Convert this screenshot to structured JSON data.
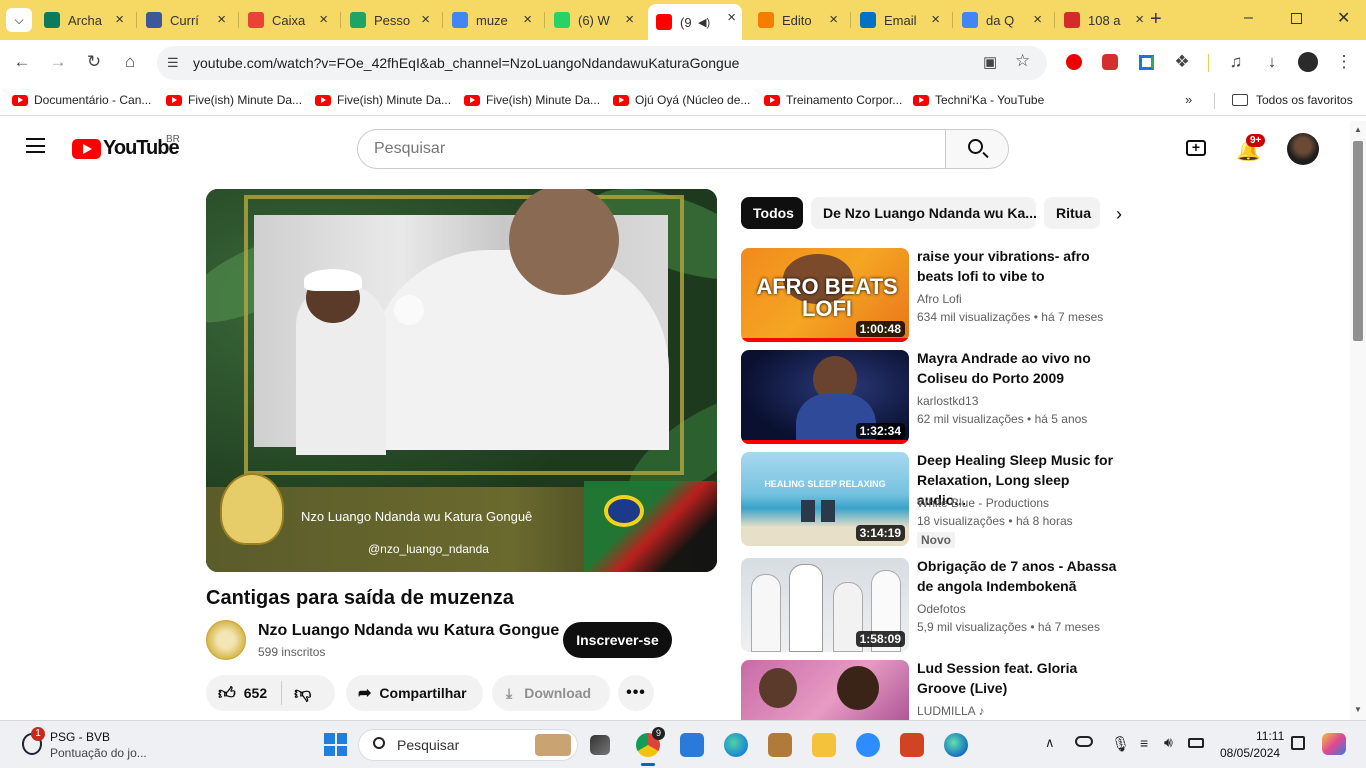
{
  "browser": {
    "tabs": [
      {
        "title": "Archa",
        "icon": "meet-icon",
        "color": "#0a7c5b"
      },
      {
        "title": "Currí",
        "icon": "globe-icon",
        "color": "#3b5998"
      },
      {
        "title": "Caixa",
        "icon": "gmail-icon",
        "color": "#ea4335"
      },
      {
        "title": "Pesso",
        "icon": "drive-icon",
        "color": "#1fa463"
      },
      {
        "title": "muze",
        "icon": "docs-icon",
        "color": "#4285f4"
      },
      {
        "title": "(6) W",
        "icon": "whatsapp-icon",
        "color": "#25d366"
      },
      {
        "title": "(9",
        "icon": "youtube-icon",
        "color": "#ff0000"
      },
      {
        "title": "Edito",
        "icon": "blogger-icon",
        "color": "#f57d00"
      },
      {
        "title": "Email",
        "icon": "outlook-icon",
        "color": "#0072c6"
      },
      {
        "title": "da Q",
        "icon": "google-icon",
        "color": "#4285f4"
      },
      {
        "title": "108 a",
        "icon": "t-icon",
        "color": "#d62b2b"
      }
    ],
    "url": "youtube.com/watch?v=FOe_42fhEqI&ab_channel=NzoLuangoNdandawuKaturaGongue",
    "bookmarks": [
      "Documentário - Can...",
      "Five(ish) Minute Da...",
      "Five(ish) Minute Da...",
      "Five(ish) Minute Da...",
      "Ojú Oyá (Núcleo de...",
      "Treinamento Corpor...",
      "Techni'Ka - YouTube"
    ],
    "all_bookmarks": "Todos os favoritos"
  },
  "youtube": {
    "logo_text": "YouTube",
    "region": "BR",
    "search_placeholder": "Pesquisar",
    "notifications": "9+",
    "video": {
      "title": "Cantigas para saída de muzenza",
      "overlay_text": "Nzo Luango Ndanda wu Katura Gonguê",
      "overlay_handle": "@nzo_luango_ndanda",
      "channel": "Nzo Luango Ndanda wu Katura Gongue",
      "subscribers": "599 inscritos",
      "subscribe": "Inscrever-se",
      "likes": "652",
      "share": "Compartilhar",
      "download": "Download"
    },
    "chips": [
      "Todos",
      "De Nzo Luango Ndanda wu Ka...",
      "Ritua"
    ],
    "recommendations": [
      {
        "title": "raise your vibrations- afro beats lofi to vibe to",
        "channel": "Afro Lofi",
        "views": "634 mil visualizações",
        "age": "há 7 meses",
        "duration": "1:00:48",
        "thumb_text": "AFRO BEATS LOFI"
      },
      {
        "title": "Mayra Andrade ao vivo no Coliseu do Porto 2009",
        "channel": "karlostkd13",
        "views": "62 mil visualizações",
        "age": "há 5 anos",
        "duration": "1:32:34",
        "thumb_text": ""
      },
      {
        "title": "Deep Healing Sleep Music for Relaxation, Long sleep audio...",
        "channel": "White Blue - Productions",
        "views": "18 visualizações",
        "age": "há 8 horas",
        "duration": "3:14:19",
        "badge": "Novo",
        "thumb_text": "HEALING SLEEP RELAXING"
      },
      {
        "title": "Obrigação de 7 anos - Abassa de angola Indembokenã",
        "channel": "Odefotos",
        "views": "5,9 mil visualizações",
        "age": "há 7 meses",
        "duration": "1:58:09",
        "thumb_text": ""
      },
      {
        "title": "Lud Session feat. Gloria Groove (Live)",
        "channel": "LUDMILLA",
        "views": "",
        "age": "",
        "duration": "",
        "thumb_text": ""
      }
    ]
  },
  "taskbar": {
    "widget_title": "PSG - BVB",
    "widget_sub": "Pontuação do jo...",
    "widget_badge": "1",
    "search": "Pesquisar",
    "time": "11:11",
    "date": "08/05/2024",
    "chrome_badge": "9"
  }
}
